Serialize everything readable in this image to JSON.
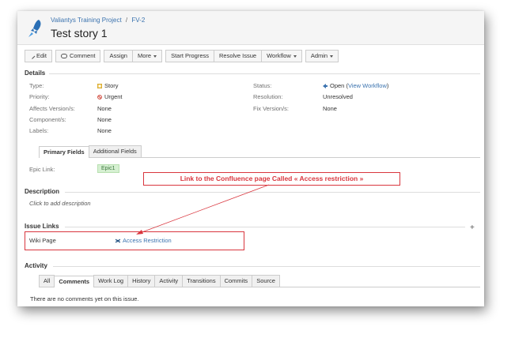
{
  "breadcrumb": {
    "project": "Valiantys Training Project",
    "separator": "/",
    "issue_key": "FV-2"
  },
  "issue_title": "Test story 1",
  "toolbar": {
    "edit": "Edit",
    "comment": "Comment",
    "assign": "Assign",
    "more": "More",
    "start_progress": "Start Progress",
    "resolve_issue": "Resolve Issue",
    "workflow": "Workflow",
    "admin": "Admin"
  },
  "details": {
    "heading": "Details",
    "type_label": "Type:",
    "type_value": "Story",
    "priority_label": "Priority:",
    "priority_value": "Urgent",
    "affects_label": "Affects Version/s:",
    "affects_value": "None",
    "components_label": "Component/s:",
    "components_value": "None",
    "labels_label": "Labels:",
    "labels_value": "None",
    "status_label": "Status:",
    "status_value": "Open",
    "status_link_open": "(",
    "status_link": "View Workflow",
    "status_link_close": ")",
    "resolution_label": "Resolution:",
    "resolution_value": "Unresolved",
    "fix_label": "Fix Version/s:",
    "fix_value": "None"
  },
  "field_tabs": [
    "Primary Fields",
    "Additional Fields"
  ],
  "epic": {
    "label": "Epic Link:",
    "value": "Epic1"
  },
  "description": {
    "heading": "Description",
    "placeholder": "Click to add description"
  },
  "annotation": "Link to the Confluence page Called « Access restriction »",
  "issue_links": {
    "heading": "Issue Links",
    "add": "+",
    "type": "Wiki Page",
    "link": "Access Restriction"
  },
  "activity": {
    "heading": "Activity",
    "tabs": [
      "All",
      "Comments",
      "Work Log",
      "History",
      "Activity",
      "Transitions",
      "Commits",
      "Source"
    ],
    "active_tab": "Comments",
    "empty": "There are no comments yet on this issue."
  },
  "colors": {
    "link": "#3b73af",
    "annotation": "#d9363e",
    "epic_bg": "#d6f0d2"
  }
}
